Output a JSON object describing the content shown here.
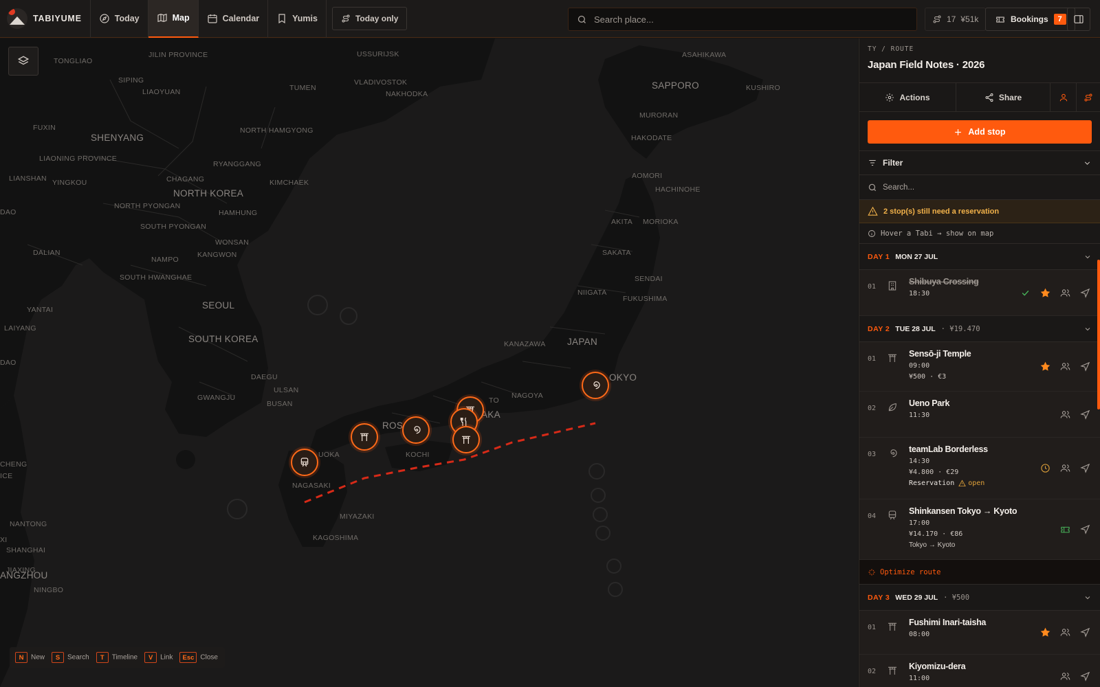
{
  "brand": {
    "name": "TABIYUME"
  },
  "nav": {
    "tabs": [
      {
        "label": "Today",
        "icon": "compass-icon"
      },
      {
        "label": "Map",
        "icon": "map-icon",
        "active": true
      },
      {
        "label": "Calendar",
        "icon": "calendar-icon"
      },
      {
        "label": "Yumis",
        "icon": "bookmark-icon"
      }
    ],
    "today_only": "Today only"
  },
  "search": {
    "placeholder": "Search place..."
  },
  "stats": {
    "stops": "17",
    "budget": "¥51k"
  },
  "bookings": {
    "label": "Bookings",
    "count": "7"
  },
  "map": {
    "labels": {
      "tonghua": "TONGLIAO",
      "jilin": "JILIN PROVINCE",
      "ussuriysk": "USSURIJSK",
      "siping": "SIPING",
      "vladivostok": "VLADIVOSTOK",
      "nakhodka": "NAKHODKA",
      "liaoyuan": "LIAOYUAN",
      "tumen": "TUMEN",
      "fuxin": "FUXIN",
      "shenyang": "SHENYANG",
      "north_hamgyong": "NORTH HAMGYONG",
      "liaoning": "LIAONING PROVINCE",
      "chagang": "CHAGANG",
      "ryanggang": "RYANGGANG",
      "lianshan": "LIANSHAN",
      "yingkou": "YINGKOU",
      "kimchaek": "KIMCHAEK",
      "north_korea": "NORTH KOREA",
      "north_pyongan": "NORTH PYONGAN",
      "hamhung": "HAMHUNG",
      "dao1": "DAO",
      "south_pyongan": "SOUTH PYONGAN",
      "wonsan": "WONSAN",
      "dalian": "DALIAN",
      "nampo": "NAMPO",
      "kangwon": "KANGWON",
      "south_hwanghae": "SOUTH HWANGHAE",
      "seoul": "SEOUL",
      "yantai": "YANTAI",
      "laiyang": "LAIYANG",
      "south_korea": "SOUTH KOREA",
      "daegu": "DAEGU",
      "ulsan": "ULSAN",
      "gwangju": "GWANGJU",
      "busan": "BUSAN",
      "dao2": "DAO",
      "cheng": "CHENG",
      "ice": "ICE",
      "nantong": "NANTONG",
      "shanghai": "SHANGHAI",
      "jiaxing": "JIAXING",
      "xi": "XI",
      "angzhou": "ANGZHOU",
      "ningbo": "NINGBO",
      "sapporo": "SAPPORO",
      "asahikawa": "ASAHIKAWA",
      "kushiro": "KUSHIRO",
      "muroran": "MURORAN",
      "hakodate": "HAKODATE",
      "aomori": "AOMORI",
      "hachinohe": "HACHINOHE",
      "akita": "AKITA",
      "morioka": "MORIOKA",
      "sakata": "SAKATA",
      "sendai": "SENDAI",
      "niigata": "NIIGATA",
      "fukushima": "FUKUSHIMA",
      "kanazawa": "KANAZAWA",
      "japan": "JAPAN",
      "okyo": "OKYO",
      "nagoya": "NAGOYA",
      "kyoto": "TO",
      "osaka": "AKA",
      "hiroshima": "ROS",
      "kochi": "KOCHI",
      "fukuoka": "UOKA",
      "nagasaki": "NAGASAKI",
      "miyazaki": "MIYAZAKI",
      "kagoshima": "KAGOSHIMA"
    }
  },
  "shortcuts": [
    {
      "key": "N",
      "label": "New"
    },
    {
      "key": "S",
      "label": "Search"
    },
    {
      "key": "T",
      "label": "Timeline"
    },
    {
      "key": "V",
      "label": "Link"
    },
    {
      "key": "Esc",
      "label": "Close"
    }
  ],
  "panel": {
    "breadcrumb": "TY / ROUTE",
    "title": "Japan Field Notes · 2026",
    "actions_label": "Actions",
    "share_label": "Share",
    "add_stop_label": "Add stop",
    "filter_label": "Filter",
    "search_placeholder": "Search...",
    "warning": "2 stop(s) still need a reservation",
    "hint": "Hover a Tabi → show on map",
    "optimize_label": "Optimize route",
    "days": [
      {
        "day": "DAY 1",
        "date": "MON 27 JUL",
        "cost": "",
        "stops": [
          {
            "num": "01",
            "title": "Shibuya Crossing",
            "time": "18:30",
            "icon": "building-icon",
            "done": true
          }
        ]
      },
      {
        "day": "DAY 2",
        "date": "TUE 28 JUL",
        "cost": "· ¥19.470",
        "stops": [
          {
            "num": "01",
            "title": "Sensō-ji Temple",
            "time": "09:00",
            "price": "¥500 · €3",
            "icon": "torii-icon"
          },
          {
            "num": "02",
            "title": "Ueno Park",
            "time": "11:30",
            "icon": "leaf-icon"
          },
          {
            "num": "03",
            "title": "teamLab Borderless",
            "time": "14:30",
            "price": "¥4.800 · €29",
            "reservation": "Reservation",
            "reservation_status": "open",
            "icon": "spiral-icon"
          },
          {
            "num": "04",
            "title": "Shinkansen Tokyo → Kyoto",
            "time": "17:00",
            "price": "¥14.170 · €86",
            "route": "Tokyo → Kyoto",
            "icon": "train-icon"
          }
        ]
      },
      {
        "day": "DAY 3",
        "date": "WED 29 JUL",
        "cost": "· ¥500",
        "stops": [
          {
            "num": "01",
            "title": "Fushimi Inari-taisha",
            "time": "08:00",
            "icon": "torii-icon"
          },
          {
            "num": "02",
            "title": "Kiyomizu-dera",
            "time": "11:00",
            "icon": "torii-icon"
          }
        ]
      }
    ]
  },
  "colors": {
    "accent": "#ff5a0e",
    "warning": "#f2b24a",
    "route": "#d62a18",
    "success": "#48b35a"
  }
}
